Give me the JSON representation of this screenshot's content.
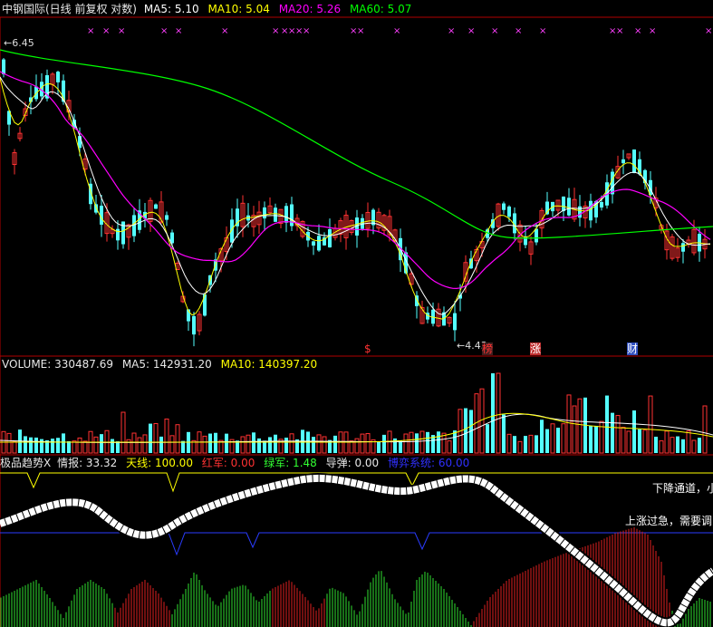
{
  "header": {
    "title": "中钢国际(日线 前复权 对数)",
    "ma5_label": "MA5: 5.10",
    "ma10_label": "MA10: 5.04",
    "ma20_label": "MA20: 5.26",
    "ma60_label": "MA60: 5.07"
  },
  "price_panel": {
    "high_marker": "6.45",
    "low_marker": "4.43",
    "event_markers": [
      "$",
      "榜",
      "涨",
      "财"
    ]
  },
  "volume_panel": {
    "volume_label": "VOLUME: 330487.69",
    "ma5_label": "MA5: 142931.20",
    "ma10_label": "MA10: 140397.20"
  },
  "indicator_panel": {
    "name": "极品趋势X",
    "qingbao_label": "情报: 33.32",
    "tianxian_label": "天线: 100.00",
    "hongjun_label": "红军: 0.00",
    "lvjun_label": "绿军: 1.48",
    "daodan_label": "导弹: 0.00",
    "boyi_label": "博弈系统: 60.00",
    "note_down": "下降通道，小",
    "note_up": "上涨过急，需要调"
  },
  "colors": {
    "ma5": "#ffff00",
    "ma10": "#ffffff",
    "ma20": "#ff00ff",
    "ma60": "#00ff00",
    "up": "#ff3232",
    "down": "#54ffff",
    "border": "#b00000"
  }
}
